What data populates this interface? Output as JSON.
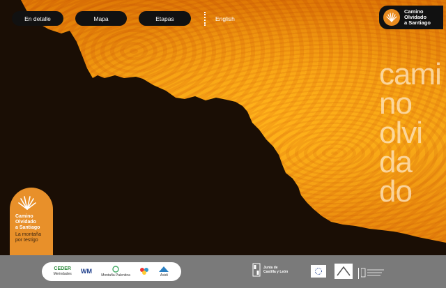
{
  "nav": {
    "items": [
      {
        "label": "En detalle"
      },
      {
        "label": "Mapa"
      },
      {
        "label": "Etapas"
      }
    ],
    "language_label": "English"
  },
  "brand": {
    "logo_line1": "Camino",
    "logo_line2": "Olvidado",
    "logo_line3": "a Santiago",
    "accent_color": "#e98b1e"
  },
  "hero": {
    "title_lines": [
      "cami",
      "no",
      "olvi",
      "da",
      "do"
    ]
  },
  "badge": {
    "title_line1": "Camino",
    "title_line2": "Olvidado",
    "title_line3": "a Santiago",
    "subtitle_line1": "La montaña",
    "subtitle_line2": "por testigo"
  },
  "footer": {
    "partners": [
      {
        "name": "CEDER",
        "sub": "Merindades"
      },
      {
        "name": "WM",
        "sub": ""
      },
      {
        "name": "",
        "sub": "Montaña Palentina"
      },
      {
        "name": "",
        "sub": ""
      },
      {
        "name": "",
        "sub": "Asidi"
      }
    ],
    "jcyl_line1": "Junta de",
    "jcyl_line2": "Castilla y León"
  }
}
